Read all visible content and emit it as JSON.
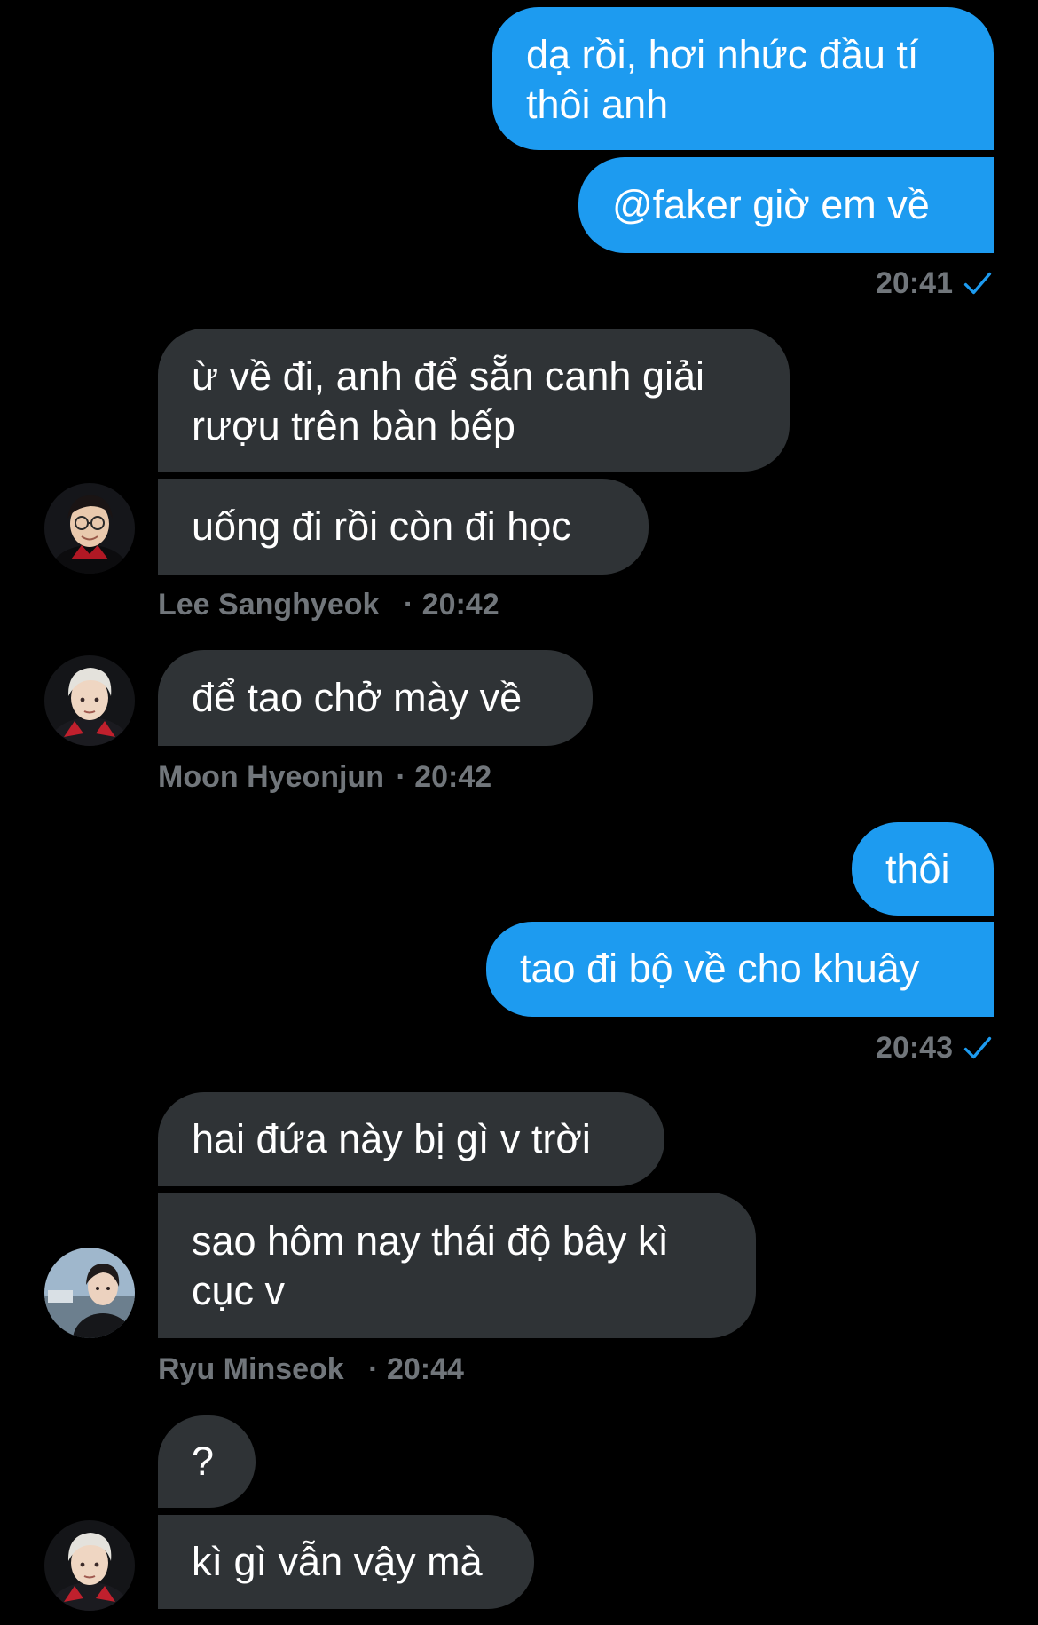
{
  "colors": {
    "background": "#000000",
    "outgoing_bubble": "#1d9bf0",
    "incoming_bubble": "#2f3336",
    "meta_text": "#71767b",
    "check": "#1d9bf0"
  },
  "messages": {
    "m1": {
      "line1": "dạ rồi, hơi nhức đầu tí",
      "line2": "thôi anh"
    },
    "m2": {
      "text": "@faker giờ em về"
    },
    "t1": {
      "time": "20:41"
    },
    "m3": {
      "line1": "ừ về đi, anh để sẵn canh giải",
      "line2": "rượu trên bàn bếp"
    },
    "m4": {
      "text": "uống đi rồi còn đi học"
    },
    "s1": {
      "name": "Lee Sanghyeok",
      "sep": "·",
      "time": "20:42"
    },
    "m5": {
      "text": "để tao chở mày về"
    },
    "s2": {
      "name": "Moon Hyeonjun",
      "sep": "·",
      "time": "20:42"
    },
    "m6": {
      "text": "thôi"
    },
    "m7": {
      "text": "tao đi bộ về cho khuây"
    },
    "t2": {
      "time": "20:43"
    },
    "m8": {
      "text": "hai đứa này bị gì v trời"
    },
    "m9": {
      "line1": "sao hôm nay thái độ bây kì",
      "line2": "cục v"
    },
    "s3": {
      "name": "Ryu Minseok",
      "sep": "·",
      "time": "20:44"
    },
    "m10": {
      "text": "?"
    },
    "m11": {
      "text": "kì gì vẫn vậy mà"
    }
  },
  "icons": {
    "read_check": "checkmark-icon",
    "avatar_lee": "avatar-lee-sanghyeok",
    "avatar_moon": "avatar-moon-hyeonjun",
    "avatar_ryu": "avatar-ryu-minseok"
  }
}
